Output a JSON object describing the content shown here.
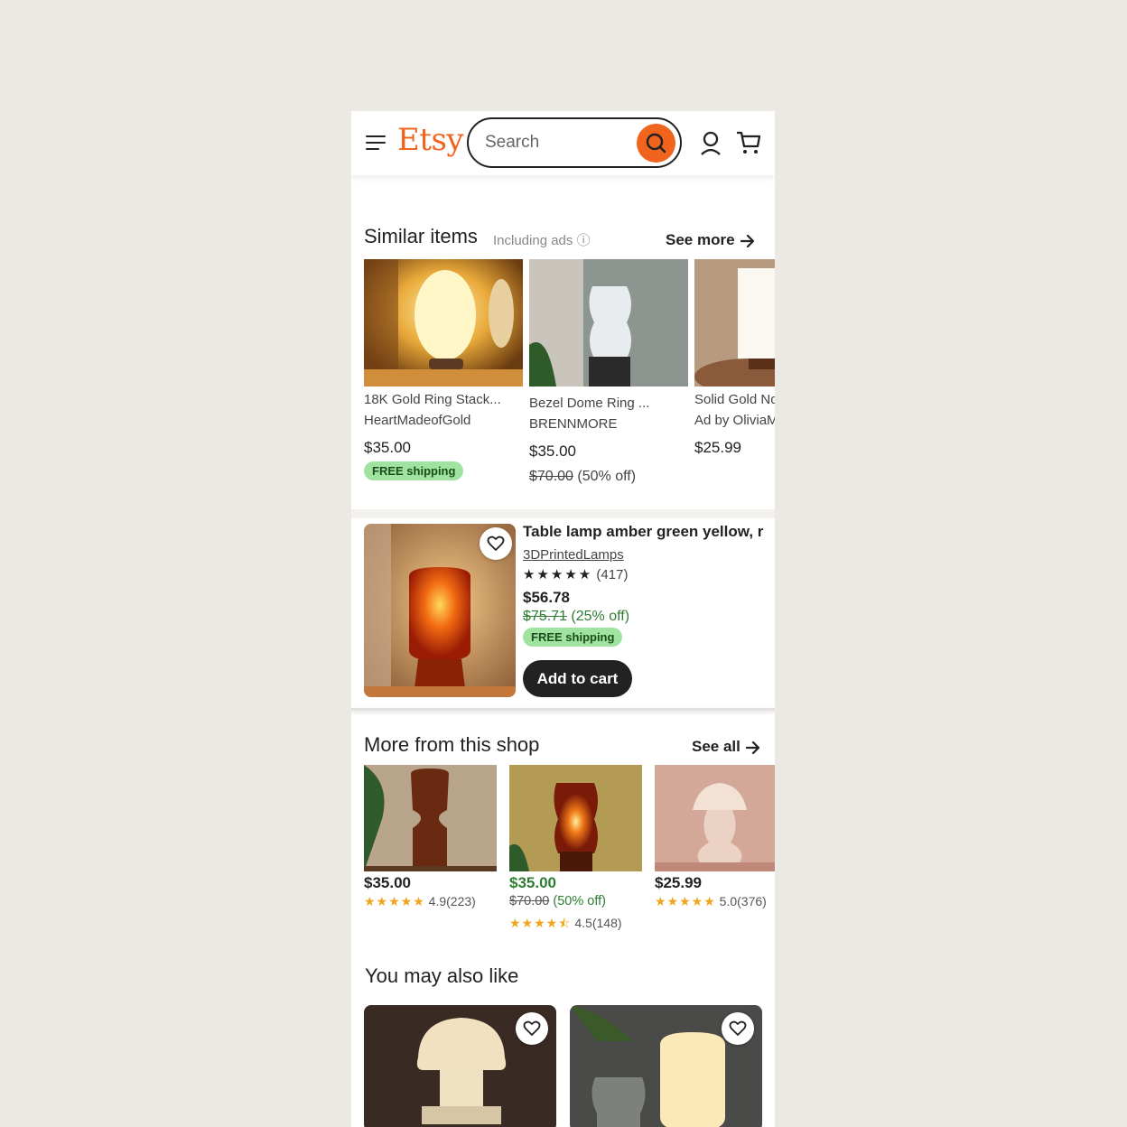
{
  "header": {
    "logo": "Etsy",
    "search_placeholder": "Search"
  },
  "similar": {
    "title": "Similar items",
    "ads_note": "Including ads ⓘ",
    "see_more": "See more",
    "items": [
      {
        "title": "18K Gold Ring Stack...",
        "shop": "HeartMadeofGold",
        "price": "$35.00",
        "badge": "FREE shipping"
      },
      {
        "title": "Bezel Dome Ring ...",
        "shop": "BRENNMORE",
        "price": "$35.00",
        "orig_price": "$70.00",
        "discount": "(50% off)"
      },
      {
        "title": "Solid Gold Nc",
        "shop": "Ad by OliviaM",
        "price": "$25.99"
      }
    ]
  },
  "featured": {
    "title": "Table lamp amber green yellow, r",
    "shop": "3DPrintedLamps",
    "stars": "★★★★★",
    "reviews": "(417)",
    "price": "$56.78",
    "orig_price": "$75.71",
    "discount": "(25% off)",
    "badge": "FREE shipping",
    "add_to_cart": "Add to cart"
  },
  "more_from_shop": {
    "title": "More from this shop",
    "see_all": "See all",
    "items": [
      {
        "price": "$35.00",
        "stars": "★★★★★",
        "rating": "4.9",
        "count": "(223)"
      },
      {
        "price": "$35.00",
        "orig_price": "$70.00",
        "discount": "(50% off)",
        "stars": "★★★★⯪",
        "rating": "4.5",
        "count": "(148)"
      },
      {
        "price": "$25.99",
        "stars": "★★★★★",
        "rating": "5.0",
        "count": "(376)"
      }
    ]
  },
  "also_like": {
    "title": "You may also like"
  },
  "colors": {
    "brand": "#f1641e",
    "badge_bg": "#a0e3a0",
    "sale_green": "#2e7d32"
  }
}
